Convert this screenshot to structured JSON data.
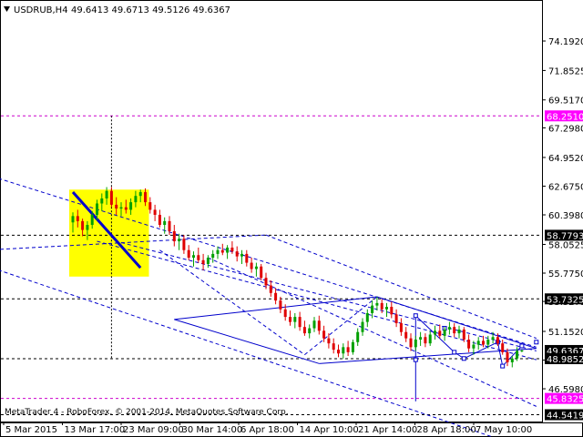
{
  "header": {
    "icon": "triangle-down-icon",
    "symbol": "USDRUB,H4",
    "ohlc": "49.6413 49.6713 49.5126 49.6367"
  },
  "copyright": "MetaTrader 4 - RoboForex, © 2001-2014, MetaQuotes Software Corp.",
  "colors": {
    "bull": "#00a000",
    "bear": "#e00000",
    "pattern": "#0000cc",
    "level": "#000000",
    "level_special": "#cc00cc",
    "highlight": "#ffff00",
    "badge_level": "#000000",
    "badge_special": "#ff00ff",
    "badge_current": "#000000"
  },
  "chart_data": {
    "type": "candlestick",
    "title": "USDRUB,H4",
    "xlabel": "",
    "ylabel": "",
    "ylim": [
      44.0,
      76.0
    ],
    "grid": false,
    "legend": "none",
    "x_tick_labels": [
      "5 Mar 2015",
      "13 Mar 17:00",
      "23 Mar 09:00",
      "30 Mar 14:00",
      "6 Apr 18:00",
      "14 Apr 10:00",
      "21 Apr 14:00",
      "28 Apr 18:00",
      "7 May 10:00"
    ],
    "y_ticks": [
      "74.1920",
      "71.8525",
      "69.5170",
      "67.2980",
      "64.9520",
      "62.6750",
      "60.3980",
      "58.0525",
      "55.7750",
      "53.5275",
      "51.1520",
      "48.8750",
      "46.5980"
    ],
    "level_badges": [
      {
        "value": 68.251,
        "label": "68.2510",
        "kind": "special"
      },
      {
        "value": 58.7793,
        "label": "58.7793",
        "kind": "level"
      },
      {
        "value": 53.7325,
        "label": "53.7325",
        "kind": "level"
      },
      {
        "value": 49.6367,
        "label": "49.6367",
        "kind": "current"
      },
      {
        "value": 48.9852,
        "label": "48.9852",
        "kind": "level"
      },
      {
        "value": 45.8325,
        "label": "45.8325",
        "kind": "special"
      },
      {
        "value": 44.5419,
        "label": "44.5419",
        "kind": "level"
      }
    ],
    "candles": [
      [
        59.8,
        60.6,
        59.0,
        60.3
      ],
      [
        60.3,
        60.8,
        59.4,
        59.9
      ],
      [
        59.9,
        60.1,
        58.7,
        59.2
      ],
      [
        59.2,
        59.9,
        58.4,
        59.6
      ],
      [
        59.6,
        60.7,
        59.3,
        60.4
      ],
      [
        60.4,
        61.6,
        60.0,
        61.3
      ],
      [
        61.3,
        62.1,
        60.7,
        61.7
      ],
      [
        61.7,
        62.6,
        61.2,
        62.3
      ],
      [
        62.3,
        62.6,
        61.0,
        61.2
      ],
      [
        61.2,
        61.8,
        60.4,
        60.9
      ],
      [
        60.9,
        61.4,
        60.3,
        61.0
      ],
      [
        61.0,
        61.6,
        60.5,
        60.8
      ],
      [
        60.8,
        61.7,
        60.4,
        61.4
      ],
      [
        61.4,
        62.3,
        61.0,
        61.9
      ],
      [
        61.9,
        62.4,
        61.4,
        62.2
      ],
      [
        62.2,
        62.5,
        61.1,
        61.4
      ],
      [
        61.4,
        61.8,
        60.5,
        60.8
      ],
      [
        60.8,
        61.2,
        59.9,
        60.4
      ],
      [
        60.4,
        60.8,
        59.4,
        59.6
      ],
      [
        59.6,
        60.2,
        58.9,
        59.9
      ],
      [
        59.9,
        60.3,
        58.8,
        59.1
      ],
      [
        59.1,
        59.6,
        57.9,
        58.3
      ],
      [
        58.3,
        58.9,
        57.6,
        58.5
      ],
      [
        58.5,
        58.8,
        57.3,
        57.6
      ],
      [
        57.6,
        58.0,
        56.8,
        57.0
      ],
      [
        57.0,
        57.5,
        56.3,
        57.2
      ],
      [
        57.2,
        57.8,
        56.6,
        56.8
      ],
      [
        56.8,
        57.3,
        56.0,
        56.5
      ],
      [
        56.5,
        57.2,
        56.2,
        57.0
      ],
      [
        57.0,
        57.6,
        56.6,
        57.3
      ],
      [
        57.3,
        57.9,
        56.9,
        57.6
      ],
      [
        57.6,
        58.1,
        57.2,
        57.4
      ],
      [
        57.4,
        58.0,
        56.9,
        57.8
      ],
      [
        57.8,
        58.3,
        57.3,
        57.5
      ],
      [
        57.5,
        57.9,
        56.7,
        57.1
      ],
      [
        57.1,
        57.6,
        56.5,
        57.3
      ],
      [
        57.3,
        57.6,
        56.3,
        56.6
      ],
      [
        56.6,
        57.0,
        55.8,
        56.1
      ],
      [
        56.1,
        56.6,
        55.5,
        56.3
      ],
      [
        56.3,
        56.5,
        55.2,
        55.4
      ],
      [
        55.4,
        55.8,
        54.5,
        54.8
      ],
      [
        54.8,
        55.2,
        53.9,
        54.2
      ],
      [
        54.2,
        54.6,
        53.3,
        53.6
      ],
      [
        53.6,
        53.9,
        52.6,
        52.9
      ],
      [
        52.9,
        53.3,
        52.0,
        52.3
      ],
      [
        52.3,
        52.8,
        51.6,
        51.9
      ],
      [
        51.9,
        52.6,
        51.4,
        52.3
      ],
      [
        52.3,
        52.7,
        51.2,
        51.5
      ],
      [
        51.5,
        52.0,
        50.8,
        51.0
      ],
      [
        51.0,
        51.7,
        50.6,
        51.4
      ],
      [
        51.4,
        52.3,
        51.1,
        52.0
      ],
      [
        52.0,
        52.4,
        50.9,
        51.2
      ],
      [
        51.2,
        51.6,
        50.3,
        50.6
      ],
      [
        50.6,
        51.0,
        49.8,
        50.2
      ],
      [
        50.2,
        50.6,
        49.4,
        49.7
      ],
      [
        49.7,
        50.1,
        49.1,
        49.4
      ],
      [
        49.4,
        50.2,
        49.0,
        49.9
      ],
      [
        49.9,
        50.4,
        49.2,
        49.5
      ],
      [
        49.5,
        50.5,
        49.3,
        50.3
      ],
      [
        50.3,
        51.4,
        50.0,
        51.1
      ],
      [
        51.1,
        52.2,
        50.8,
        51.9
      ],
      [
        51.9,
        52.9,
        51.5,
        52.6
      ],
      [
        52.6,
        53.6,
        52.2,
        53.2
      ],
      [
        53.2,
        53.9,
        52.8,
        53.4
      ],
      [
        53.4,
        53.7,
        52.6,
        52.9
      ],
      [
        52.9,
        53.4,
        52.3,
        53.1
      ],
      [
        53.1,
        53.5,
        52.2,
        52.5
      ],
      [
        52.5,
        52.9,
        51.5,
        51.8
      ],
      [
        51.8,
        52.2,
        50.8,
        51.1
      ],
      [
        51.1,
        51.5,
        50.3,
        50.6
      ],
      [
        50.6,
        51.0,
        49.6,
        49.9
      ],
      [
        49.9,
        50.8,
        49.6,
        50.5
      ],
      [
        50.5,
        51.1,
        50.0,
        50.7
      ],
      [
        50.7,
        51.0,
        49.9,
        50.2
      ],
      [
        50.2,
        51.2,
        50.0,
        50.9
      ],
      [
        50.9,
        51.6,
        50.5,
        51.2
      ],
      [
        51.2,
        51.7,
        50.6,
        50.8
      ],
      [
        50.8,
        51.5,
        50.4,
        51.3
      ],
      [
        51.3,
        51.9,
        50.9,
        51.5
      ],
      [
        51.5,
        51.8,
        50.7,
        51.0
      ],
      [
        51.0,
        51.6,
        50.6,
        51.3
      ],
      [
        51.3,
        51.5,
        50.3,
        50.5
      ],
      [
        50.5,
        50.9,
        49.5,
        49.8
      ],
      [
        49.8,
        50.4,
        49.3,
        50.1
      ],
      [
        50.1,
        50.7,
        49.7,
        50.4
      ],
      [
        50.4,
        50.8,
        49.9,
        50.1
      ],
      [
        50.1,
        50.8,
        49.8,
        50.5
      ],
      [
        50.5,
        51.1,
        50.2,
        50.7
      ],
      [
        50.7,
        51.0,
        50.0,
        50.2
      ],
      [
        50.2,
        50.5,
        49.3,
        49.5
      ],
      [
        49.5,
        49.8,
        48.4,
        48.7
      ],
      [
        48.7,
        49.2,
        48.3,
        49.0
      ],
      [
        49.0,
        49.9,
        48.8,
        49.6
      ],
      [
        49.6,
        49.7,
        49.5,
        49.6367
      ]
    ],
    "pattern_lines": [
      {
        "from": [
          0,
          62.2
        ],
        "to": [
          14,
          56.2
        ],
        "style": "solid",
        "width": 3,
        "color": "pattern"
      },
      {
        "from": [
          -23,
          64.2
        ],
        "to": [
          96,
          49.9
        ],
        "style": "dashed",
        "color": "pattern"
      },
      {
        "from": [
          -23,
          57.0
        ],
        "to": [
          96,
          41.6
        ],
        "style": "dashed",
        "color": "pattern"
      },
      {
        "from": [
          5,
          58.3
        ],
        "to": [
          96,
          48.9
        ],
        "style": "dashed",
        "color": "pattern"
      },
      {
        "from": [
          -23,
          57.5
        ],
        "to": [
          40,
          58.8
        ],
        "style": "dashed",
        "color": "pattern"
      },
      {
        "from": [
          40,
          58.8
        ],
        "to": [
          96,
          50.6
        ],
        "style": "dashed",
        "color": "pattern"
      },
      {
        "from": [
          10,
          58.2
        ],
        "to": [
          96,
          49.6
        ],
        "style": "dashed",
        "color": "pattern"
      },
      {
        "from": [
          18,
          57.6
        ],
        "to": [
          48,
          49.3
        ],
        "style": "dashed",
        "color": "pattern"
      },
      {
        "from": [
          48,
          49.3
        ],
        "to": [
          63,
          53.9
        ],
        "style": "dashed",
        "color": "pattern"
      },
      {
        "from": [
          28,
          57.0
        ],
        "to": [
          96,
          45.2
        ],
        "style": "dashed",
        "color": "pattern"
      },
      {
        "from": [
          21,
          52.1
        ],
        "to": [
          63,
          53.9
        ],
        "style": "solid",
        "color": "pattern"
      },
      {
        "from": [
          63,
          53.9
        ],
        "to": [
          96,
          49.8
        ],
        "style": "solid",
        "color": "pattern"
      },
      {
        "from": [
          21,
          52.1
        ],
        "to": [
          51,
          48.6
        ],
        "style": "solid",
        "color": "pattern"
      },
      {
        "from": [
          51,
          48.6
        ],
        "to": [
          96,
          49.8
        ],
        "style": "solid",
        "color": "pattern"
      },
      {
        "from": [
          71,
          52.4
        ],
        "to": [
          71,
          45.6
        ],
        "style": "solid",
        "color": "pattern"
      },
      {
        "from": [
          71,
          52.4
        ],
        "to": [
          79,
          49.5
        ],
        "style": "solid",
        "color": "pattern"
      },
      {
        "from": [
          79,
          49.5
        ],
        "to": [
          81,
          49.0
        ],
        "style": "solid",
        "color": "pattern"
      },
      {
        "from": [
          81,
          49.0
        ],
        "to": [
          88,
          50.3
        ],
        "style": "solid",
        "color": "pattern"
      },
      {
        "from": [
          88,
          50.3
        ],
        "to": [
          89,
          48.4
        ],
        "style": "solid",
        "color": "pattern"
      },
      {
        "from": [
          89,
          48.4
        ],
        "to": [
          93,
          50.0
        ],
        "style": "solid",
        "color": "pattern"
      }
    ],
    "pattern_markers": [
      {
        "at": [
          71,
          52.4
        ]
      },
      {
        "at": [
          79,
          49.5
        ]
      },
      {
        "at": [
          81,
          49.0
        ]
      },
      {
        "at": [
          88,
          50.3
        ]
      },
      {
        "at": [
          89,
          48.4
        ]
      },
      {
        "at": [
          93,
          50.0
        ]
      },
      {
        "at": [
          96,
          50.3
        ]
      },
      {
        "at": [
          77,
          51.4
        ]
      },
      {
        "at": [
          71,
          48.9
        ]
      }
    ],
    "highlight_box": {
      "x": [
        0,
        15
      ],
      "y": [
        55.5,
        62.4
      ]
    },
    "crosshair": {
      "at": 8,
      "y_range": [
        48.9,
        68.25
      ]
    }
  }
}
